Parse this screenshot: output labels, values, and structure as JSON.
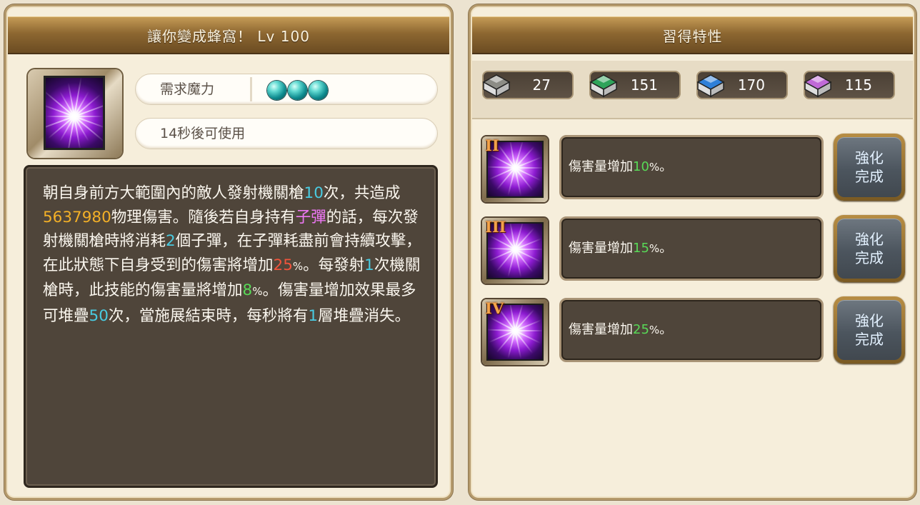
{
  "skill": {
    "title": "讓你變成蜂窩！ Lv 100",
    "mana_label": "需求魔力",
    "mana_orbs": 3,
    "cooldown_text": "14秒後可使用",
    "description": [
      {
        "t": "朝自身前方大範圍內的敵人發射機關槍"
      },
      {
        "t": "10",
        "c": "cyan"
      },
      {
        "t": "次，共造成"
      },
      {
        "t": "5637980",
        "c": "gold"
      },
      {
        "t": "物理傷害。隨後若自身持有"
      },
      {
        "t": "子彈",
        "c": "pink"
      },
      {
        "t": "的話，每次發射機關槍時將消耗"
      },
      {
        "t": "2",
        "c": "cyan"
      },
      {
        "t": "個子彈，在子彈耗盡前會持續攻擊，在此狀態下自身受到的傷害將增加"
      },
      {
        "t": "25",
        "c": "red"
      },
      {
        "t": "%",
        "c": "pct"
      },
      {
        "t": "。每發射"
      },
      {
        "t": "1",
        "c": "cyan"
      },
      {
        "t": "次機關槍時，此技能的傷害量將增加"
      },
      {
        "t": "8",
        "c": "green"
      },
      {
        "t": "%",
        "c": "pct"
      },
      {
        "t": "。傷害量增加效果最多可堆疊"
      },
      {
        "t": "50",
        "c": "cyan"
      },
      {
        "t": "次，當施展結束時，每秒將有"
      },
      {
        "t": "1",
        "c": "cyan"
      },
      {
        "t": "層堆疊消失。"
      }
    ]
  },
  "traits": {
    "title": "習得特性",
    "resources": [
      {
        "icon": "gray-book-icon",
        "value": "27",
        "color": "#8c8c86"
      },
      {
        "icon": "green-book-icon",
        "value": "151",
        "color": "#2fa35a"
      },
      {
        "icon": "blue-book-icon",
        "value": "170",
        "color": "#2f7fd8"
      },
      {
        "icon": "pink-book-icon",
        "value": "115",
        "color": "#c06ad8"
      }
    ],
    "rows": [
      {
        "roman": "II",
        "prefix": "傷害量增加",
        "value": "10",
        "suffix": "%",
        "end": "。",
        "btn_line1": "強化",
        "btn_line2": "完成"
      },
      {
        "roman": "III",
        "prefix": "傷害量增加",
        "value": "15",
        "suffix": "%",
        "end": "。",
        "btn_line1": "強化",
        "btn_line2": "完成"
      },
      {
        "roman": "IV",
        "prefix": "傷害量增加",
        "value": "25",
        "suffix": "%",
        "end": "。",
        "btn_line1": "強化",
        "btn_line2": "完成"
      }
    ]
  }
}
